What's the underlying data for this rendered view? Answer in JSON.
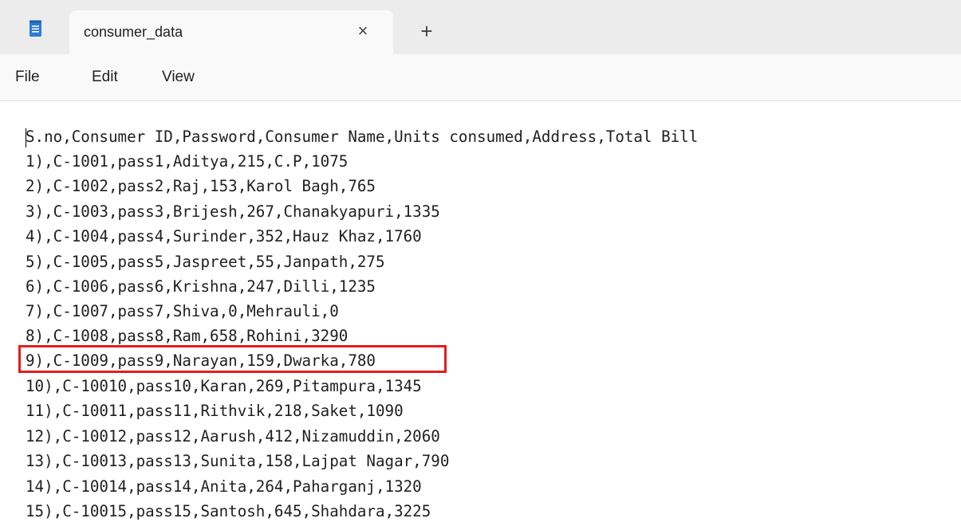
{
  "window": {
    "tab_title": "consumer_data",
    "close_symbol": "×",
    "new_tab_symbol": "+"
  },
  "menu": {
    "items": [
      "File",
      "Edit",
      "View"
    ]
  },
  "document": {
    "lines": [
      "S.no,Consumer ID,Password,Consumer Name,Units consumed,Address,Total Bill",
      "1),C-1001,pass1,Aditya,215,C.P,1075",
      "2),C-1002,pass2,Raj,153,Karol Bagh,765",
      "3),C-1003,pass3,Brijesh,267,Chanakyapuri,1335",
      "4),C-1004,pass4,Surinder,352,Hauz Khaz,1760",
      "5),C-1005,pass5,Jaspreet,55,Janpath,275",
      "6),C-1006,pass6,Krishna,247,Dilli,1235",
      "7),C-1007,pass7,Shiva,0,Mehrauli,0",
      "8),C-1008,pass8,Ram,658,Rohini,3290",
      "9),C-1009,pass9,Narayan,159,Dwarka,780",
      "10),C-10010,pass10,Karan,269,Pitampura,1345",
      "11),C-10011,pass11,Rithvik,218,Saket,1090",
      "12),C-10012,pass12,Aarush,412,Nizamuddin,2060",
      "13),C-10013,pass13,Sunita,158,Lajpat Nagar,790",
      "14),C-10014,pass14,Anita,264,Paharganj,1320",
      "15),C-10015,pass15,Santosh,645,Shahdara,3225"
    ],
    "highlighted_line_index": 9,
    "highlight_color": "#e21e1e"
  }
}
